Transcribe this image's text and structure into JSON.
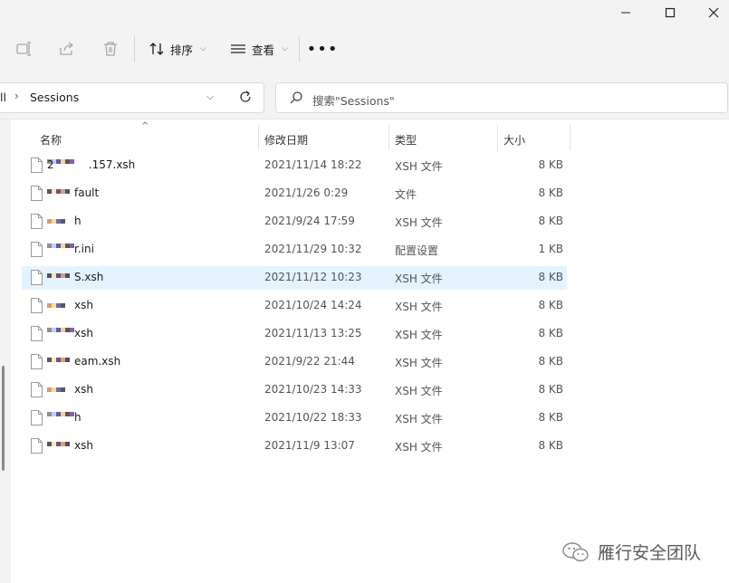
{
  "window": {
    "controls": [
      "minimize",
      "maximize",
      "close"
    ]
  },
  "toolbar": {
    "sort_label": "排序",
    "view_label": "查看",
    "more_label": "•••"
  },
  "address": {
    "crumb_prev": "ll",
    "crumb_current": "Sessions"
  },
  "search": {
    "placeholder": "搜索\"Sessions\""
  },
  "columns": {
    "name": "名称",
    "modified": "修改日期",
    "type": "类型",
    "size": "大小"
  },
  "files": [
    {
      "name": "2          .157.xsh",
      "date": "2021/11/14 18:22",
      "type": "XSH 文件",
      "size": "8 KB"
    },
    {
      "name": "fault",
      "date": "2021/1/26 0:29",
      "type": "文件",
      "size": "8 KB"
    },
    {
      "name": "h",
      "date": "2021/9/24 17:59",
      "type": "XSH 文件",
      "size": "8 KB"
    },
    {
      "name": "r.ini",
      "date": "2021/11/29 10:32",
      "type": "配置设置",
      "size": "1 KB"
    },
    {
      "name": "S.xsh",
      "date": "2021/11/12 10:23",
      "type": "XSH 文件",
      "size": "8 KB"
    },
    {
      "name": "xsh",
      "date": "2021/10/24 14:24",
      "type": "XSH 文件",
      "size": "8 KB"
    },
    {
      "name": "xsh",
      "date": "2021/11/13 13:25",
      "type": "XSH 文件",
      "size": "8 KB"
    },
    {
      "name": "eam.xsh",
      "date": "2021/9/22 21:44",
      "type": "XSH 文件",
      "size": "8 KB"
    },
    {
      "name": "xsh",
      "date": "2021/10/23 14:33",
      "type": "XSH 文件",
      "size": "8 KB"
    },
    {
      "name": "h",
      "date": "2021/10/22 18:33",
      "type": "XSH 文件",
      "size": "8 KB"
    },
    {
      "name": "xsh",
      "date": "2021/11/9 13:07",
      "type": "XSH 文件",
      "size": "8 KB"
    }
  ],
  "selected_index": 4,
  "watermark": {
    "text": "雁行安全团队"
  },
  "colors": {
    "chrome_bg": "#f3f3f3",
    "selection": "#e5f3ff",
    "text": "#1a1a1a"
  }
}
